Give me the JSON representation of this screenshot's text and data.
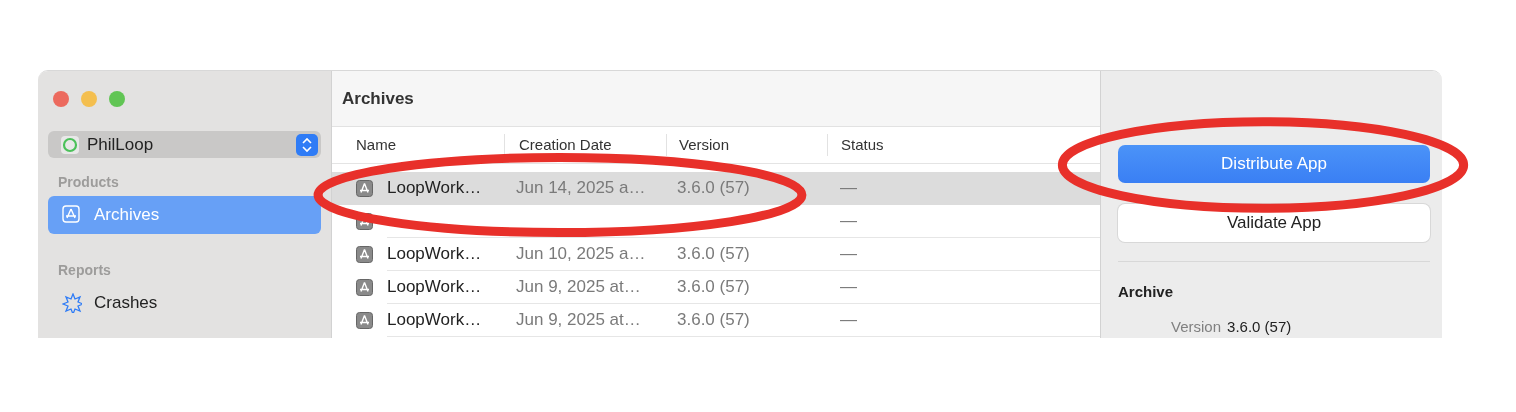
{
  "sidebar": {
    "scheme": {
      "label": "PhilLoop"
    },
    "sections": [
      {
        "title": "Products",
        "items": [
          {
            "label": "Archives",
            "selected": true
          }
        ]
      },
      {
        "title": "Reports",
        "items": [
          {
            "label": "Crashes",
            "selected": false
          }
        ]
      }
    ]
  },
  "archives": {
    "title": "Archives",
    "columns": [
      {
        "label": "Name"
      },
      {
        "label": "Creation Date"
      },
      {
        "label": "Version"
      },
      {
        "label": "Status"
      }
    ],
    "rows": [
      {
        "name": "LoopWork…",
        "date": "Jun 14, 2025 a…",
        "version": "3.6.0 (57)",
        "status": "—",
        "selected": true
      },
      {
        "status": "—",
        "selected": false
      },
      {
        "name": "LoopWork…",
        "date": "Jun 10, 2025 a…",
        "version": "3.6.0 (57)",
        "status": "—",
        "selected": false
      },
      {
        "name": "LoopWork…",
        "date": "Jun 9, 2025 at…",
        "version": "3.6.0 (57)",
        "status": "—",
        "selected": false
      },
      {
        "name": "LoopWork…",
        "date": "Jun 9, 2025 at…",
        "version": "3.6.0 (57)",
        "status": "—",
        "selected": false
      }
    ]
  },
  "inspector": {
    "buttons": [
      {
        "label": "Distribute App",
        "kind": "primary"
      },
      {
        "label": "Validate App",
        "kind": "secondary"
      }
    ],
    "section": "Archive",
    "fields": [
      {
        "label": "Version",
        "value": "3.6.0 (57)"
      }
    ]
  },
  "annotations": [
    {
      "kind": "ellipse",
      "color": "#e8302a"
    },
    {
      "kind": "ellipse",
      "color": "#e8302a"
    }
  ]
}
